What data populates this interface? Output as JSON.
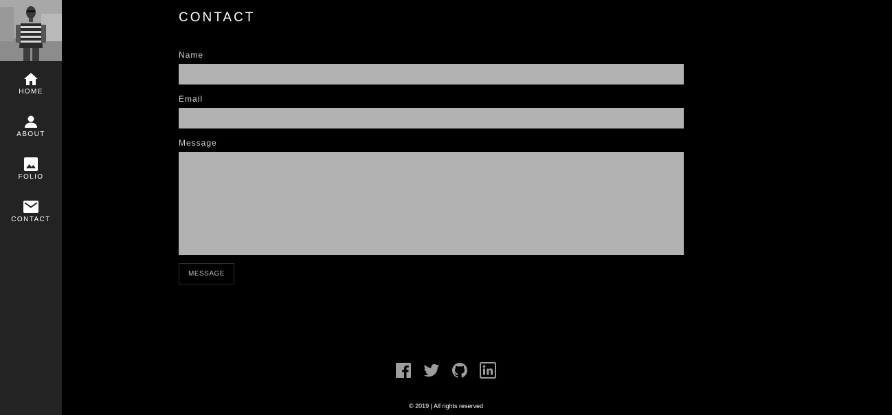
{
  "sidebar": {
    "nav": [
      {
        "label": "HOME",
        "icon": "home-icon"
      },
      {
        "label": "ABOUT",
        "icon": "person-icon"
      },
      {
        "label": "FOLIO",
        "icon": "image-icon"
      },
      {
        "label": "CONTACT",
        "icon": "mail-icon"
      }
    ]
  },
  "main": {
    "title": "CONTACT",
    "form": {
      "name_label": "Name",
      "name_value": "",
      "email_label": "Email",
      "email_value": "",
      "message_label": "Message",
      "message_value": "",
      "submit_label": "MESSAGE"
    }
  },
  "footer": {
    "social": [
      "facebook-icon",
      "twitter-icon",
      "github-icon",
      "linkedin-icon"
    ],
    "copyright": "© 2019 | All rights reserved"
  },
  "colors": {
    "background": "#000000",
    "sidebar": "#232323",
    "field": "#b2b2b2",
    "icon_gray": "#9e9e9e"
  }
}
